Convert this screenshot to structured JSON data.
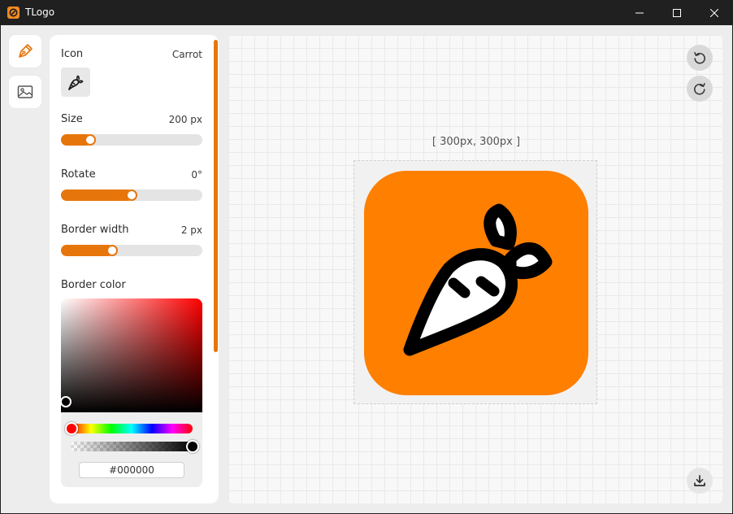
{
  "window": {
    "title": "TLogo",
    "controls": [
      "minimize-icon",
      "maximize-icon",
      "close-icon"
    ]
  },
  "rail": {
    "items": [
      {
        "name": "icon-editor",
        "icon": "pen-nib-icon",
        "active": true
      },
      {
        "name": "background-editor",
        "icon": "image-icon",
        "active": false
      }
    ]
  },
  "panel": {
    "icon": {
      "label": "Icon",
      "value": "Carrot",
      "icon": "carrot-icon"
    },
    "size": {
      "label": "Size",
      "value": "200 px",
      "fraction": 0.18
    },
    "rotate": {
      "label": "Rotate",
      "value": "0°",
      "fraction": 0.5
    },
    "border_width": {
      "label": "Border width",
      "value": "2 px",
      "fraction": 0.35
    },
    "border_color": {
      "label": "Border color",
      "hex": "#000000",
      "hue_fraction": 0.0,
      "alpha_fraction": 1.0
    }
  },
  "canvas": {
    "dimensions_label": "[ 300px, 300px ]",
    "logo_background": "#ff7f00",
    "icon_color": "#000000",
    "icon_fill": "#ffffff",
    "actions": [
      "undo-icon",
      "redo-icon",
      "download-icon"
    ]
  },
  "colors": {
    "accent": "#e6760b",
    "logo_orange": "#ff7f00"
  }
}
